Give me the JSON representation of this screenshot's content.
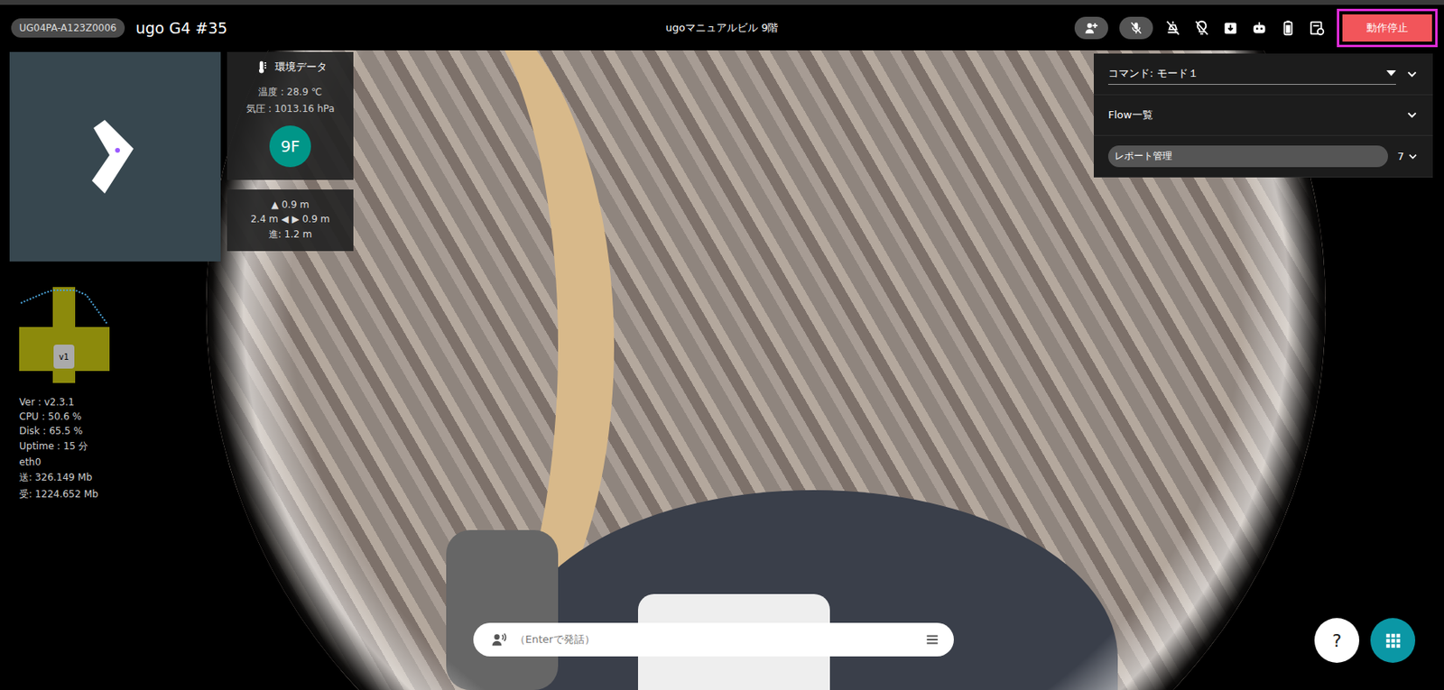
{
  "header": {
    "robot_id": "UG04PA-A123Z0006",
    "robot_name": "ugo G4 #35",
    "location": "ugoマニュアルビル 9階",
    "stop_button": "動作停止"
  },
  "environment": {
    "title": "環境データ",
    "temperature": "温度 : 28.9 ℃",
    "pressure": "気圧 : 1013.16 hPa",
    "floor": "9F"
  },
  "distances": {
    "front": "▲ 0.9 m",
    "sides": "2.4 m ◀ ▶ 0.9 m",
    "forward": "進: 1.2 m"
  },
  "lidar": {
    "label": "v1"
  },
  "stats": [
    "Ver : v2.3.1",
    "CPU : 50.6 %",
    "Disk : 65.5 %",
    "Uptime : 15 分",
    "eth0",
    "送: 326.149 Mb",
    "受: 1224.652 Mb"
  ],
  "side_panel": {
    "command": "コマンド: モード１",
    "flow": "Flow一覧",
    "report": "レポート管理",
    "report_count": "7"
  },
  "speech": {
    "placeholder": "（Enterで発話）"
  },
  "help": "?"
}
